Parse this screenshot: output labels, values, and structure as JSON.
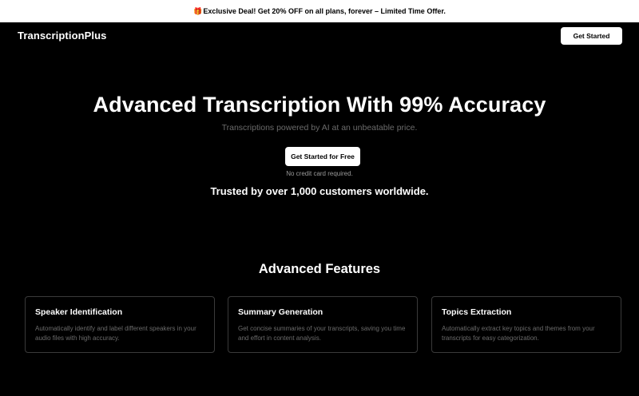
{
  "promo": {
    "icon": "gift-icon",
    "icon_glyph": "🎁",
    "text": "Exclusive Deal! Get 20% OFF on all plans, forever – Limited Time Offer."
  },
  "nav": {
    "brand": "TranscriptionPlus",
    "cta_label": "Get Started"
  },
  "hero": {
    "title": "Advanced Transcription With 99% Accuracy",
    "subtitle": "Transcriptions powered by AI at an unbeatable price.",
    "cta_label": "Get Started for Free",
    "note": "No credit card required.",
    "trusted": "Trusted by over 1,000 customers worldwide."
  },
  "features": {
    "title": "Advanced Features",
    "cards": [
      {
        "title": "Speaker Identification",
        "description": "Automatically identify and label different speakers in your audio files with high accuracy."
      },
      {
        "title": "Summary Generation",
        "description": "Get concise summaries of your transcripts, saving you time and effort in content analysis."
      },
      {
        "title": "Topics Extraction",
        "description": "Automatically extract key topics and themes from your transcripts for easy categorization."
      }
    ]
  },
  "colors": {
    "background": "#000000",
    "primary_text": "#ffffff",
    "muted_text": "#6b6b6b",
    "card_border": "#3a3a3a",
    "button_bg": "#ffffff",
    "button_text": "#000000"
  }
}
